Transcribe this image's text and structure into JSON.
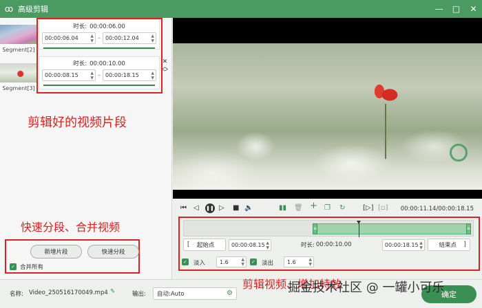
{
  "window": {
    "title": "高级剪辑",
    "controls": [
      "—",
      "□",
      "✕"
    ]
  },
  "segments": [
    {
      "label": "Segment[2]",
      "duration_label": "时长:",
      "duration": "00:00:06.00",
      "start": "00:00:06.04",
      "end": "00:00:12.04"
    },
    {
      "label": "Segment[3]",
      "duration_label": "时长:",
      "duration": "00:00:10.00",
      "start": "00:00:08.15",
      "end": "00:00:18.15"
    }
  ],
  "annotations": {
    "clips": "剪辑好的视频片段",
    "split_merge": "快速分段、合并视频",
    "effects": "剪辑视频、增加特效"
  },
  "left_actions": {
    "new_segment": "新增片段",
    "quick_split": "快速分段",
    "merge_all": "合并所有"
  },
  "player": {
    "timecode": "00:00:11.14/00:00:18.15"
  },
  "trim": {
    "start_label": "起始点",
    "start_value": "00:00:08.15",
    "duration_label": "时长:",
    "duration_value": "00:00:10.00",
    "end_value": "00:00:18.15",
    "end_label": "结束点",
    "fade_in_label": "淡入",
    "fade_in_value": "1.6",
    "fade_out_label": "淡出",
    "fade_out_value": "1.6"
  },
  "bottom": {
    "name_label": "名称:",
    "filename": "Video_250516170049.mp4",
    "output_label": "输出:",
    "output_value": "自动:Auto",
    "ok_button": "确定"
  },
  "watermark": "掘金技术社区 @ 一罐小可乐",
  "colors": {
    "accent": "#4a9a62",
    "annotation": "#e02020"
  }
}
